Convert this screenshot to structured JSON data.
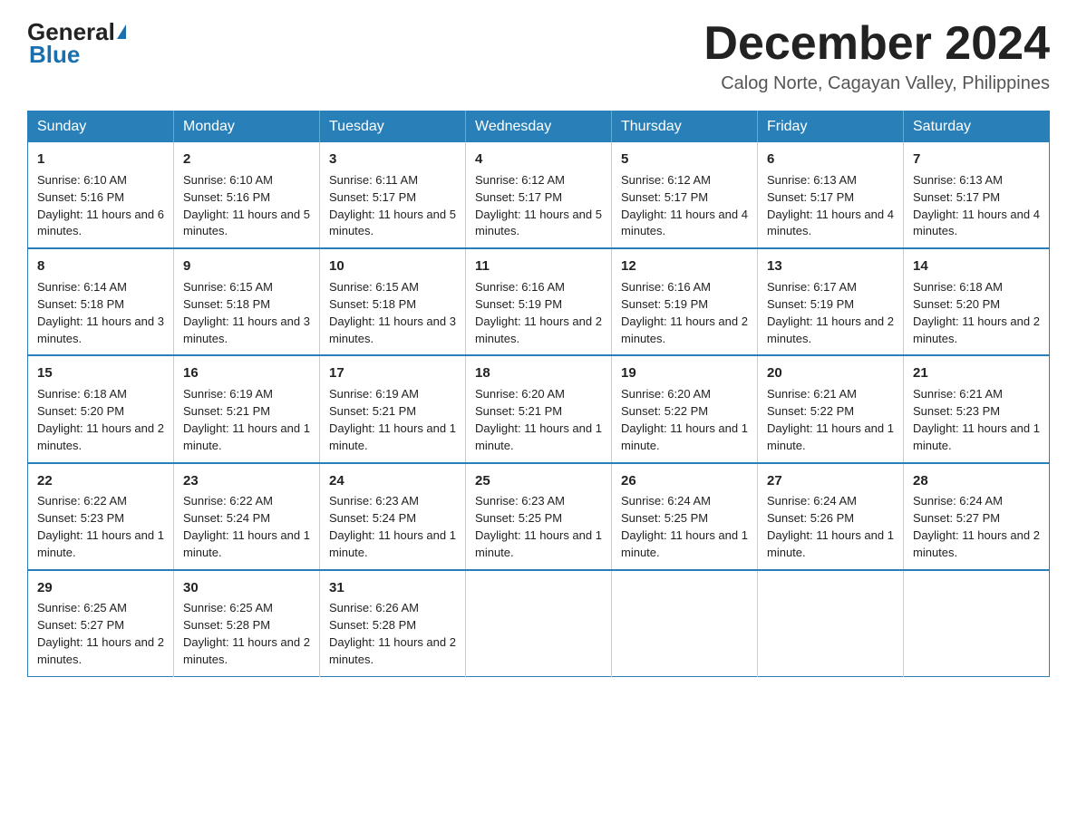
{
  "logo": {
    "text_general": "General",
    "text_blue": "Blue"
  },
  "title": {
    "month": "December 2024",
    "location": "Calog Norte, Cagayan Valley, Philippines"
  },
  "weekdays": [
    "Sunday",
    "Monday",
    "Tuesday",
    "Wednesday",
    "Thursday",
    "Friday",
    "Saturday"
  ],
  "weeks": [
    [
      {
        "day": "1",
        "sunrise": "6:10 AM",
        "sunset": "5:16 PM",
        "daylight": "11 hours and 6 minutes."
      },
      {
        "day": "2",
        "sunrise": "6:10 AM",
        "sunset": "5:16 PM",
        "daylight": "11 hours and 5 minutes."
      },
      {
        "day": "3",
        "sunrise": "6:11 AM",
        "sunset": "5:17 PM",
        "daylight": "11 hours and 5 minutes."
      },
      {
        "day": "4",
        "sunrise": "6:12 AM",
        "sunset": "5:17 PM",
        "daylight": "11 hours and 5 minutes."
      },
      {
        "day": "5",
        "sunrise": "6:12 AM",
        "sunset": "5:17 PM",
        "daylight": "11 hours and 4 minutes."
      },
      {
        "day": "6",
        "sunrise": "6:13 AM",
        "sunset": "5:17 PM",
        "daylight": "11 hours and 4 minutes."
      },
      {
        "day": "7",
        "sunrise": "6:13 AM",
        "sunset": "5:17 PM",
        "daylight": "11 hours and 4 minutes."
      }
    ],
    [
      {
        "day": "8",
        "sunrise": "6:14 AM",
        "sunset": "5:18 PM",
        "daylight": "11 hours and 3 minutes."
      },
      {
        "day": "9",
        "sunrise": "6:15 AM",
        "sunset": "5:18 PM",
        "daylight": "11 hours and 3 minutes."
      },
      {
        "day": "10",
        "sunrise": "6:15 AM",
        "sunset": "5:18 PM",
        "daylight": "11 hours and 3 minutes."
      },
      {
        "day": "11",
        "sunrise": "6:16 AM",
        "sunset": "5:19 PM",
        "daylight": "11 hours and 2 minutes."
      },
      {
        "day": "12",
        "sunrise": "6:16 AM",
        "sunset": "5:19 PM",
        "daylight": "11 hours and 2 minutes."
      },
      {
        "day": "13",
        "sunrise": "6:17 AM",
        "sunset": "5:19 PM",
        "daylight": "11 hours and 2 minutes."
      },
      {
        "day": "14",
        "sunrise": "6:18 AM",
        "sunset": "5:20 PM",
        "daylight": "11 hours and 2 minutes."
      }
    ],
    [
      {
        "day": "15",
        "sunrise": "6:18 AM",
        "sunset": "5:20 PM",
        "daylight": "11 hours and 2 minutes."
      },
      {
        "day": "16",
        "sunrise": "6:19 AM",
        "sunset": "5:21 PM",
        "daylight": "11 hours and 1 minute."
      },
      {
        "day": "17",
        "sunrise": "6:19 AM",
        "sunset": "5:21 PM",
        "daylight": "11 hours and 1 minute."
      },
      {
        "day": "18",
        "sunrise": "6:20 AM",
        "sunset": "5:21 PM",
        "daylight": "11 hours and 1 minute."
      },
      {
        "day": "19",
        "sunrise": "6:20 AM",
        "sunset": "5:22 PM",
        "daylight": "11 hours and 1 minute."
      },
      {
        "day": "20",
        "sunrise": "6:21 AM",
        "sunset": "5:22 PM",
        "daylight": "11 hours and 1 minute."
      },
      {
        "day": "21",
        "sunrise": "6:21 AM",
        "sunset": "5:23 PM",
        "daylight": "11 hours and 1 minute."
      }
    ],
    [
      {
        "day": "22",
        "sunrise": "6:22 AM",
        "sunset": "5:23 PM",
        "daylight": "11 hours and 1 minute."
      },
      {
        "day": "23",
        "sunrise": "6:22 AM",
        "sunset": "5:24 PM",
        "daylight": "11 hours and 1 minute."
      },
      {
        "day": "24",
        "sunrise": "6:23 AM",
        "sunset": "5:24 PM",
        "daylight": "11 hours and 1 minute."
      },
      {
        "day": "25",
        "sunrise": "6:23 AM",
        "sunset": "5:25 PM",
        "daylight": "11 hours and 1 minute."
      },
      {
        "day": "26",
        "sunrise": "6:24 AM",
        "sunset": "5:25 PM",
        "daylight": "11 hours and 1 minute."
      },
      {
        "day": "27",
        "sunrise": "6:24 AM",
        "sunset": "5:26 PM",
        "daylight": "11 hours and 1 minute."
      },
      {
        "day": "28",
        "sunrise": "6:24 AM",
        "sunset": "5:27 PM",
        "daylight": "11 hours and 2 minutes."
      }
    ],
    [
      {
        "day": "29",
        "sunrise": "6:25 AM",
        "sunset": "5:27 PM",
        "daylight": "11 hours and 2 minutes."
      },
      {
        "day": "30",
        "sunrise": "6:25 AM",
        "sunset": "5:28 PM",
        "daylight": "11 hours and 2 minutes."
      },
      {
        "day": "31",
        "sunrise": "6:26 AM",
        "sunset": "5:28 PM",
        "daylight": "11 hours and 2 minutes."
      },
      null,
      null,
      null,
      null
    ]
  ]
}
